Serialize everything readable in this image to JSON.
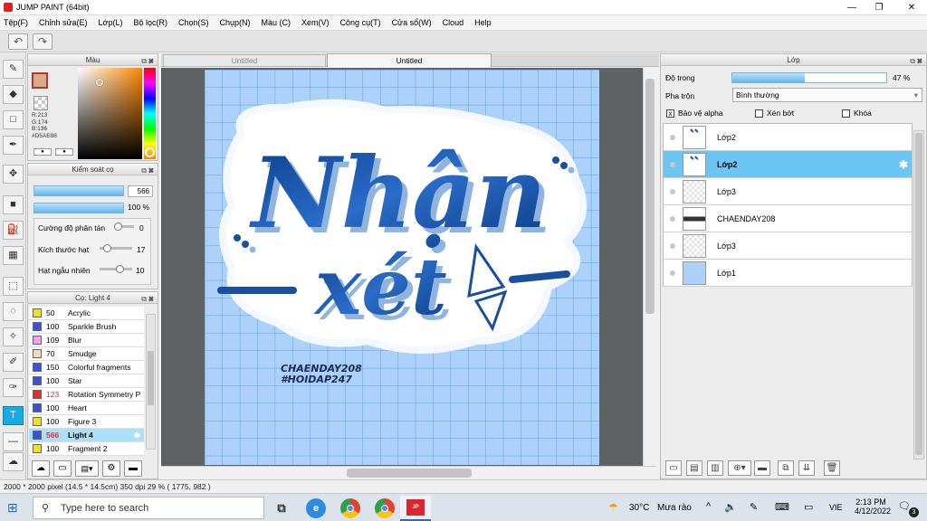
{
  "app": {
    "title": "JUMP PAINT (64bit)"
  },
  "menu": [
    "Tệp(F)",
    "Chỉnh sửa(E)",
    "Lớp(L)",
    "Bộ lọc(R)",
    "Chọn(S)",
    "Chụp(N)",
    "Màu (C)",
    "Xem(V)",
    "Công cụ(T)",
    "Cửa sổ(W)",
    "Cloud",
    "Help"
  ],
  "color_panel": {
    "title": "Màu",
    "r": "R:213",
    "g": "G:174",
    "b": "B:136",
    "hex": "#D5AE88",
    "fg": "#D5AE88",
    "bg": "#4f7fe0"
  },
  "brush_control": {
    "title": "Kiểm soát cọ",
    "size": "566",
    "opacity": "100 %",
    "opacity_fraction": 1.0,
    "size_fraction": 0.9,
    "scatter_label": "Cường độ phân tán",
    "scatter_val": "0",
    "particle_label": "Kích thước hạt",
    "particle_val": "17",
    "random_label": "Hạt ngẫu nhiên",
    "random_val": "10"
  },
  "brush_list": {
    "title": "Cọ: Light 4",
    "items": [
      {
        "size": "50",
        "name": "Acrylic",
        "color": "#f0e020"
      },
      {
        "size": "100",
        "name": "Sparkle Brush",
        "color": "#3a50e0"
      },
      {
        "size": "109",
        "name": "Blur",
        "color": "#f0a0f0"
      },
      {
        "size": "70",
        "name": "Smudge",
        "color": "#f4d8b8"
      },
      {
        "size": "150",
        "name": "Colorful fragments",
        "color": "#3a50e0"
      },
      {
        "size": "100",
        "name": "Star",
        "color": "#3a50e0"
      },
      {
        "size": "123",
        "name": "Rotation Symmetry P",
        "color": "#e03030"
      },
      {
        "size": "100",
        "name": "Heart",
        "color": "#3a50e0"
      },
      {
        "size": "100",
        "name": "Figure 3",
        "color": "#f0e020"
      },
      {
        "size": "566",
        "name": "Light 4",
        "color": "#3a50e0"
      },
      {
        "size": "100",
        "name": "Fragment 2",
        "color": "#f0e020"
      }
    ]
  },
  "tabs": [
    "Untitled",
    "Untitled"
  ],
  "canvas": {
    "word1": "Nhận",
    "word2": "xét",
    "caption1": "CHAENDAY208",
    "caption2": "#HOIDAP247"
  },
  "layer_panel": {
    "title": "Lớp",
    "opacity_label": "Độ trong",
    "opacity_value": "47 %",
    "opacity_fraction": 0.47,
    "blend_label": "Pha trộn",
    "blend_value": "Bình thường",
    "protect_alpha": "Bảo vệ alpha",
    "clip": "Xén bớt",
    "lock": "Khóa",
    "layers": [
      {
        "name": "Lớp2",
        "thumb": "art"
      },
      {
        "name": "Lớp2",
        "thumb": "art"
      },
      {
        "name": "Lớp3",
        "thumb": "empty"
      },
      {
        "name": "CHAENDAY208",
        "thumb": "text"
      },
      {
        "name": "Lớp3",
        "thumb": "empty"
      },
      {
        "name": "Lớp1",
        "thumb": "blue"
      }
    ]
  },
  "status": {
    "text": "2000 * 2000 pixel  (14.5 * 14.5cm)  350 dpi  29 %  ( 1775, 982 )"
  },
  "taskbar": {
    "search_placeholder": "Type here to search",
    "weather_temp": "30°C",
    "weather_text": "Mưa rào",
    "lang": "VIE",
    "time": "2:13 PM",
    "date": "4/12/2022",
    "notif": "3"
  }
}
